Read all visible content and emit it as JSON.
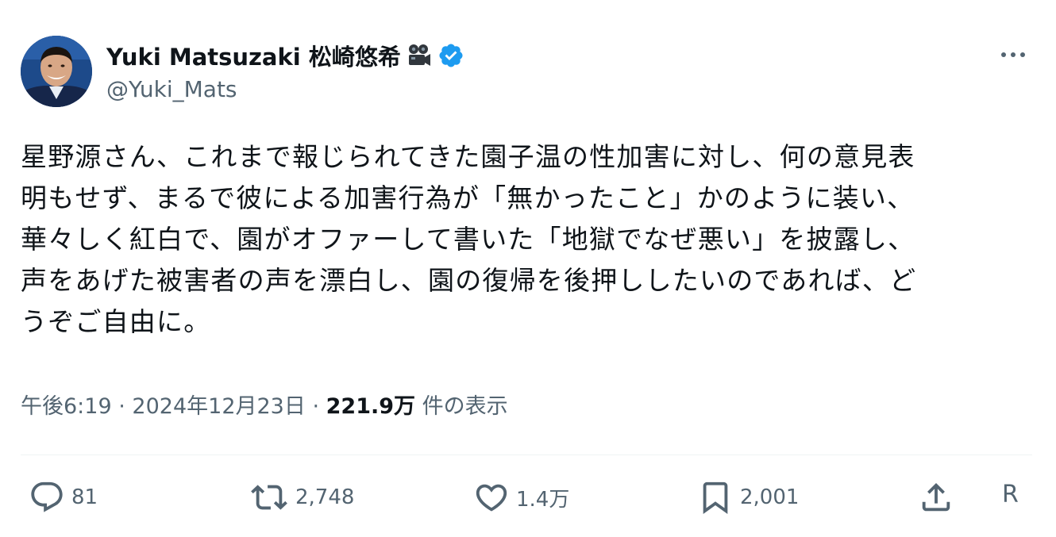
{
  "author": {
    "display_name": "Yuki Matsuzaki 松崎悠希",
    "name_emoji_icon": "movie-camera-icon",
    "verified_icon": "verified-badge-icon",
    "handle": "@Yuki_Mats"
  },
  "tweet": {
    "lines": [
      "星野源さん、これまで報じられてきた園子温の性加害に対し、何の意見表",
      "明もせず、まるで彼による加害行為が「無かったこと」かのように装い、",
      "華々しく紅白で、園がオファーして書いた「地獄でなぜ悪い」を披露し、",
      "声をあげた被害者の声を漂白し、園の復帰を後押ししたいのであれば、ど",
      "うぞご自由に。"
    ],
    "time": "午後6:19",
    "separator": "·",
    "date": "2024年12月23日",
    "views_count": "221.9万",
    "views_label": "件の表示"
  },
  "actions": {
    "reply_count": "81",
    "retweet_count": "2,748",
    "like_count": "1.4万",
    "bookmark_count": "2,001",
    "trailing_text": "R"
  },
  "colors": {
    "text_primary": "#0f1419",
    "text_secondary": "#536471",
    "verified_blue": "#1d9bf0",
    "divider": "#eff3f4"
  }
}
